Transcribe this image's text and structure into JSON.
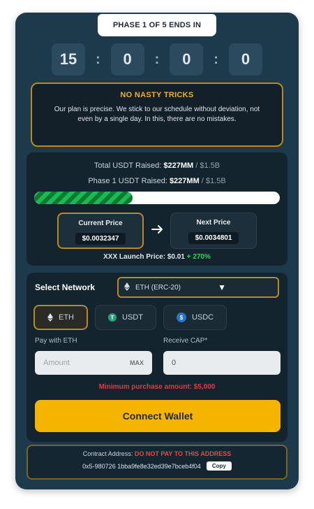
{
  "phase": {
    "label": "PHASE 1 OF 5 ENDS IN"
  },
  "countdown": {
    "days": "15",
    "hours": "0",
    "minutes": "0",
    "seconds": "0",
    "separator": ":"
  },
  "notice": {
    "title": "NO NASTY TRICKS",
    "text": "Our plan is precise. We stick to our schedule without deviation, not even by a single day. In this, there are no mistakes."
  },
  "stats": {
    "total_raised_label": "Total USDT Raised:",
    "total_raised_value": "$227MM",
    "total_raised_target": "/ $1.5B",
    "phase_raised_label": "Phase 1 USDT Raised:",
    "phase_raised_value": "$227MM",
    "phase_raised_target": "/ $1.5B",
    "progress_fraction": 0.4
  },
  "prices": {
    "current_label": "Current Price",
    "current_value": "$0.0032347",
    "next_label": "Next Price",
    "next_value": "$0.0034801",
    "launch_label": "XXX Launch Price:",
    "launch_value": "$0.01",
    "launch_change": "+ 270%"
  },
  "network": {
    "label": "Select Network",
    "selected": "ETH (ERC-20)"
  },
  "tokens": [
    {
      "name": "ETH",
      "icon": "eth-icon",
      "active": true
    },
    {
      "name": "USDT",
      "icon": "usdt-icon",
      "active": false
    },
    {
      "name": "USDC",
      "icon": "usdc-icon",
      "active": false
    }
  ],
  "fields": {
    "pay_label": "Pay with ETH",
    "pay_placeholder": "Amount",
    "max_label": "MAX",
    "receive_label": "Receive CAP*",
    "receive_value": "0"
  },
  "warning": "Minimum purchase amount: $5,000",
  "connect_label": "Connect Wallet",
  "contract": {
    "label": "Contract Address:",
    "warning": "DO NOT PAY TO THIS ADDRESS",
    "address": "0x5-980726 1bba9fe8e32ed39e7bceb4f04",
    "copy_label": "Copy"
  },
  "colors": {
    "card_bg": "#1d3a4c",
    "accent_gold": "#b88a1f",
    "button_yellow": "#f4b400",
    "progress_green": "#1db954",
    "warning_red": "#e03b3b"
  }
}
